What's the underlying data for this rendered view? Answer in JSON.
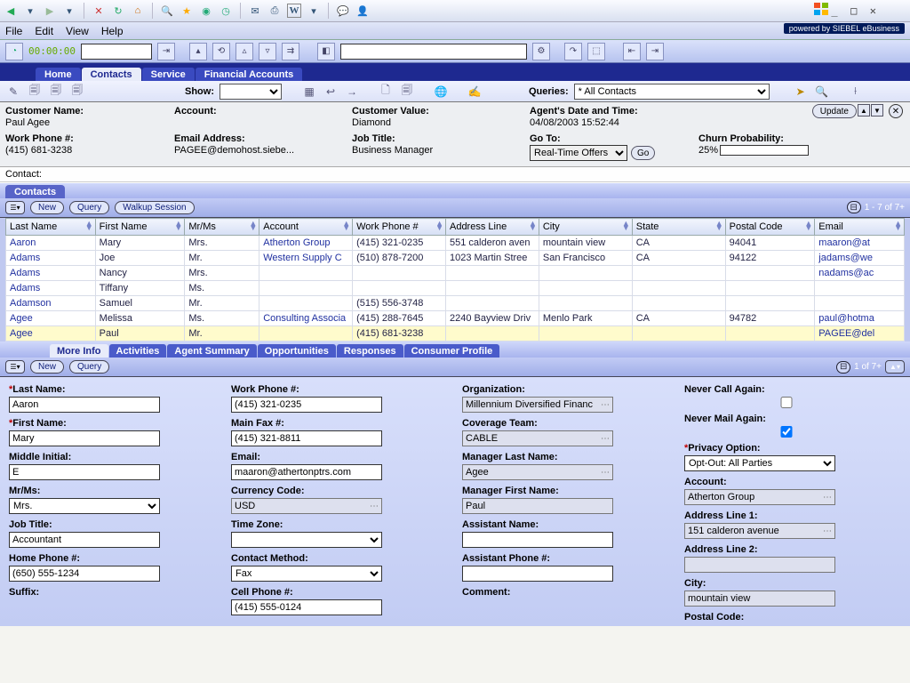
{
  "menu": {
    "file": "File",
    "edit": "Edit",
    "view": "View",
    "help": "Help"
  },
  "brand": "powered by SIEBEL eBusiness",
  "nav_timer": "00:00:00",
  "primary_tabs": {
    "home": "Home",
    "contacts": "Contacts",
    "service": "Service",
    "fin": "Financial Accounts"
  },
  "toolbar2": {
    "show_label": "Show:",
    "queries_label": "Queries:",
    "queries_value": "* All Contacts"
  },
  "info": {
    "customer_name_lbl": "Customer Name:",
    "customer_name": "Paul Agee",
    "account_lbl": "Account:",
    "account": "",
    "cust_value_lbl": "Customer Value:",
    "cust_value": "Diamond",
    "agent_dt_lbl": "Agent's Date and Time:",
    "agent_dt": "04/08/2003 15:52:44",
    "work_phone_lbl": "Work Phone #:",
    "work_phone": "(415) 681-3238",
    "email_lbl": "Email Address:",
    "email": "PAGEE@demohost.siebe...",
    "job_title_lbl": "Job Title:",
    "job_title": "Business Manager",
    "goto_lbl": "Go To:",
    "goto_value": "Real-Time Offers",
    "go_btn": "Go",
    "churn_lbl": "Churn Probability:",
    "churn_pct": "25%",
    "churn_fill": 25,
    "update_btn": "Update"
  },
  "contact_bar_label": "Contact:",
  "contacts_applet": {
    "title": "Contacts",
    "new_btn": "New",
    "query_btn": "Query",
    "walkup_btn": "Walkup Session",
    "record_counter": "1 - 7 of 7+",
    "cols": [
      "Last Name",
      "First Name",
      "Mr/Ms",
      "Account",
      "Work Phone #",
      "Address Line",
      "City",
      "State",
      "Postal Code",
      "Email"
    ],
    "rows": [
      {
        "ln": "Aaron",
        "fn": "Mary",
        "sal": "Mrs.",
        "acct": "Atherton Group",
        "ph": "(415) 321-0235",
        "addr": "551 calderon aven",
        "city": "mountain view",
        "st": "CA",
        "zip": "94041",
        "em": "maaron@at"
      },
      {
        "ln": "Adams",
        "fn": "Joe",
        "sal": "Mr.",
        "acct": "Western Supply C",
        "ph": "(510) 878-7200",
        "addr": "1023 Martin Stree",
        "city": "San Francisco",
        "st": "CA",
        "zip": "94122",
        "em": "jadams@we"
      },
      {
        "ln": "Adams",
        "fn": "Nancy",
        "sal": "Mrs.",
        "acct": "",
        "ph": "",
        "addr": "",
        "city": "",
        "st": "",
        "zip": "",
        "em": "nadams@ac"
      },
      {
        "ln": "Adams",
        "fn": "Tiffany",
        "sal": "Ms.",
        "acct": "",
        "ph": "",
        "addr": "",
        "city": "",
        "st": "",
        "zip": "",
        "em": ""
      },
      {
        "ln": "Adamson",
        "fn": "Samuel",
        "sal": "Mr.",
        "acct": "",
        "ph": "(515) 556-3748",
        "addr": "",
        "city": "",
        "st": "",
        "zip": "",
        "em": ""
      },
      {
        "ln": "Agee",
        "fn": "Melissa",
        "sal": "Ms.",
        "acct": "Consulting Associa",
        "ph": "(415) 288-7645",
        "addr": "2240 Bayview Driv",
        "city": "Menlo Park",
        "st": "CA",
        "zip": "94782",
        "em": "paul@hotma"
      },
      {
        "ln": "Agee",
        "fn": "Paul",
        "sal": "Mr.",
        "acct": "",
        "ph": "(415) 681-3238",
        "addr": "",
        "city": "",
        "st": "",
        "zip": "",
        "em": "PAGEE@del"
      }
    ]
  },
  "detail_tabs": {
    "more": "More Info",
    "act": "Activities",
    "agent": "Agent Summary",
    "opp": "Opportunities",
    "resp": "Responses",
    "prof": "Consumer Profile"
  },
  "detail_tb": {
    "new_btn": "New",
    "query_btn": "Query",
    "record_counter": "1 of 7+"
  },
  "form": {
    "last_name_lbl": "Last Name:",
    "last_name": "Aaron",
    "first_name_lbl": "First Name:",
    "first_name": "Mary",
    "mi_lbl": "Middle Initial:",
    "mi": "E",
    "sal_lbl": "Mr/Ms:",
    "sal": "Mrs.",
    "job_lbl": "Job Title:",
    "job": "Accountant",
    "home_ph_lbl": "Home Phone #:",
    "home_ph": "(650) 555-1234",
    "suffix_lbl": "Suffix:",
    "work_ph_lbl": "Work Phone #:",
    "work_ph": "(415) 321-0235",
    "fax_lbl": "Main Fax #:",
    "fax": "(415) 321-8811",
    "email_lbl": "Email:",
    "email": "maaron@athertonptrs.com",
    "curr_lbl": "Currency Code:",
    "curr": "USD",
    "tz_lbl": "Time Zone:",
    "tz": "",
    "cm_lbl": "Contact Method:",
    "cm": "Fax",
    "cell_lbl": "Cell Phone #:",
    "cell": "(415) 555-0124",
    "org_lbl": "Organization:",
    "org": "Millennium Diversified Financ",
    "cov_lbl": "Coverage Team:",
    "cov": "CABLE",
    "mgr_ln_lbl": "Manager Last Name:",
    "mgr_ln": "Agee",
    "mgr_fn_lbl": "Manager First Name:",
    "mgr_fn": "Paul",
    "asst_lbl": "Assistant Name:",
    "asst": "",
    "asst_ph_lbl": "Assistant Phone #:",
    "asst_ph": "",
    "comment_lbl": "Comment:",
    "nca_lbl": "Never Call Again:",
    "nma_lbl": "Never Mail Again:",
    "priv_lbl": "Privacy Option:",
    "priv": "Opt-Out: All Parties",
    "acct_lbl": "Account:",
    "acct": "Atherton Group",
    "addr1_lbl": "Address Line 1:",
    "addr1": "151 calderon avenue",
    "addr2_lbl": "Address Line 2:",
    "addr2": "",
    "city_lbl": "City:",
    "city": "mountain view",
    "zip_lbl": "Postal Code:"
  }
}
